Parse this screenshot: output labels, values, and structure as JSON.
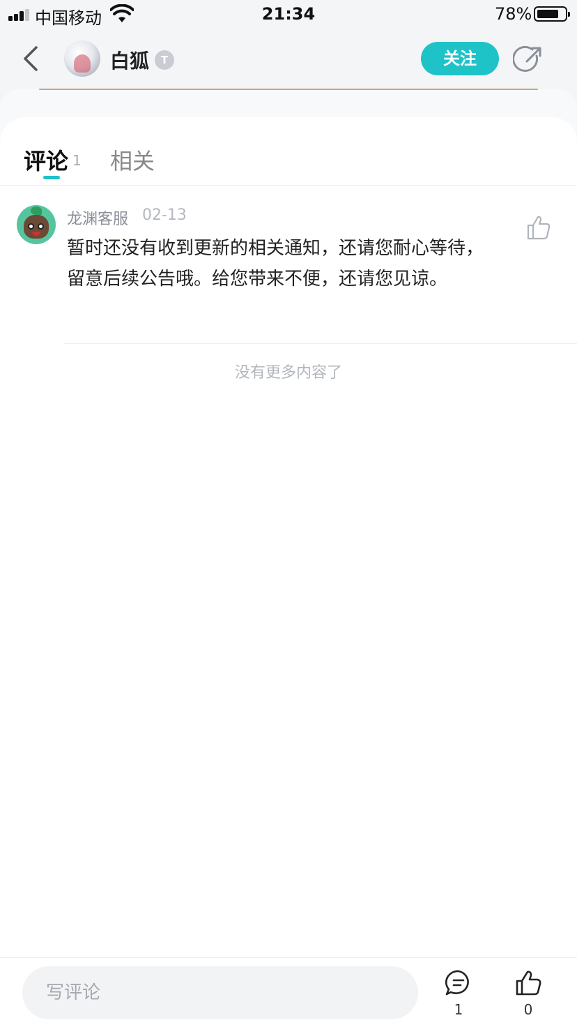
{
  "status_bar": {
    "carrier": "中国移动",
    "time": "21:34",
    "battery": "78%",
    "battery_level": 0.78
  },
  "header": {
    "username": "白狐",
    "badge": "T",
    "follow_label": "关注"
  },
  "tabs": {
    "comments_label": "评论",
    "comments_count": "1",
    "related_label": "相关"
  },
  "comments": [
    {
      "author": "龙渊客服",
      "date": "02-13",
      "text": "暂时还没有收到更新的相关通知，还请您耐心等待，留意后续公告哦。给您带来不便，还请您见谅。"
    }
  ],
  "footer_note": "没有更多内容了",
  "bottom_bar": {
    "input_placeholder": "写评论",
    "comment_count": "1",
    "like_count": "0"
  },
  "colors": {
    "accent": "#1ec3c7",
    "header_bg": "#f4f5f7"
  }
}
